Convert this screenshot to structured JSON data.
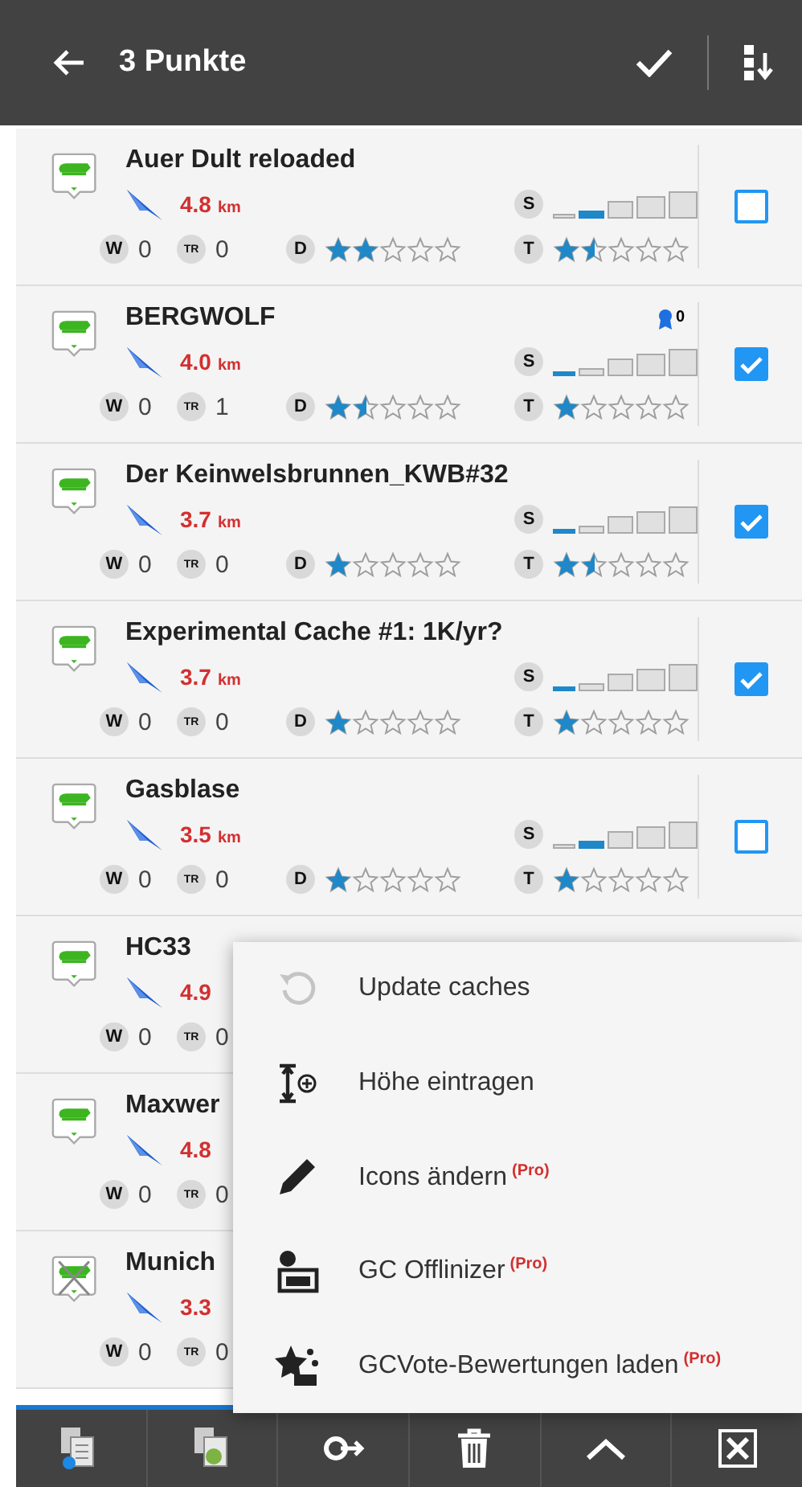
{
  "header": {
    "title": "3 Punkte"
  },
  "caches": [
    {
      "kind": "active",
      "name": "Auer Dult reloaded",
      "distance": "4.8",
      "unit": "km",
      "w_label": "W",
      "w_count": "0",
      "tr_label": "TR",
      "tr_count": "0",
      "d_label": "D",
      "difficulty": {
        "stars": 2
      },
      "t_label": "T",
      "terrain": {
        "stars": 1.5
      },
      "s_label": "S",
      "size": [
        {
          "selected": false
        },
        {
          "selected": true
        },
        {
          "selected": false
        },
        {
          "selected": false
        },
        {
          "selected": false
        }
      ],
      "checked": false
    },
    {
      "kind": "active",
      "name": "BERGWOLF",
      "favorites": "0",
      "distance": "4.0",
      "unit": "km",
      "w_label": "W",
      "w_count": "0",
      "tr_label": "TR",
      "tr_count": "1",
      "d_label": "D",
      "difficulty": {
        "stars": 1.5
      },
      "t_label": "T",
      "terrain": {
        "stars": 1
      },
      "s_label": "S",
      "size": [
        {
          "selected": true
        },
        {
          "selected": false
        },
        {
          "selected": false
        },
        {
          "selected": false
        },
        {
          "selected": false
        }
      ],
      "checked": true
    },
    {
      "kind": "active",
      "name": "Der Keinwelsbrunnen_KWB#32",
      "distance": "3.7",
      "unit": "km",
      "w_label": "W",
      "w_count": "0",
      "tr_label": "TR",
      "tr_count": "0",
      "d_label": "D",
      "difficulty": {
        "stars": 1
      },
      "t_label": "T",
      "terrain": {
        "stars": 1.5
      },
      "s_label": "S",
      "size": [
        {
          "selected": true
        },
        {
          "selected": false
        },
        {
          "selected": false
        },
        {
          "selected": false
        },
        {
          "selected": false
        }
      ],
      "checked": true
    },
    {
      "kind": "active",
      "name": "Experimental Cache #1: 1K/yr?",
      "distance": "3.7",
      "unit": "km",
      "w_label": "W",
      "w_count": "0",
      "tr_label": "TR",
      "tr_count": "0",
      "d_label": "D",
      "difficulty": {
        "stars": 1
      },
      "t_label": "T",
      "terrain": {
        "stars": 1
      },
      "s_label": "S",
      "size": [
        {
          "selected": true
        },
        {
          "selected": false
        },
        {
          "selected": false
        },
        {
          "selected": false
        },
        {
          "selected": false
        }
      ],
      "checked": true
    },
    {
      "kind": "active",
      "name": "Gasblase",
      "distance": "3.5",
      "unit": "km",
      "w_label": "W",
      "w_count": "0",
      "tr_label": "TR",
      "tr_count": "0",
      "d_label": "D",
      "difficulty": {
        "stars": 1
      },
      "t_label": "T",
      "terrain": {
        "stars": 1
      },
      "s_label": "S",
      "size": [
        {
          "selected": false
        },
        {
          "selected": true
        },
        {
          "selected": false
        },
        {
          "selected": false
        },
        {
          "selected": false
        }
      ],
      "checked": false
    },
    {
      "kind": "active",
      "name": "HC33",
      "distance": "4.9",
      "w_label": "W",
      "w_count": "0",
      "tr_label": "TR",
      "tr_count": "0"
    },
    {
      "kind": "active",
      "name": "Maxwer",
      "distance": "4.8",
      "w_label": "W",
      "w_count": "0",
      "tr_label": "TR",
      "tr_count": "0"
    },
    {
      "kind": "archived",
      "name": "Munich",
      "distance": "3.3",
      "w_label": "W",
      "w_count": "0",
      "tr_label": "TR",
      "tr_count": "0"
    }
  ],
  "menu": [
    {
      "kind": "refresh",
      "label": "Update caches",
      "disabled": true
    },
    {
      "kind": "height",
      "label": "Höhe eintragen",
      "disabled": false
    },
    {
      "kind": "pencil",
      "label": "Icons ändern",
      "badge": "(Pro)",
      "disabled": false
    },
    {
      "kind": "offline",
      "label": "GC Offlinizer",
      "badge": "(Pro)",
      "disabled": false
    },
    {
      "kind": "vote",
      "label": "GCVote-Bewertungen laden",
      "badge": "(Pro)",
      "disabled": false
    }
  ],
  "toolbar": [
    {
      "kind": "copy"
    },
    {
      "kind": "export"
    },
    {
      "kind": "key"
    },
    {
      "kind": "delete"
    },
    {
      "kind": "up"
    },
    {
      "kind": "close"
    }
  ]
}
